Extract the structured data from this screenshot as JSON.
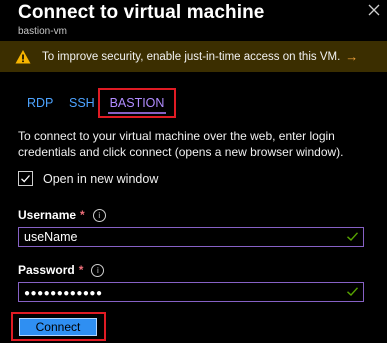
{
  "header": {
    "title": "Connect to virtual machine",
    "subtitle": "bastion-vm"
  },
  "banner": {
    "text": "To improve security, enable just-in-time access on this VM.",
    "arrow": "→",
    "warning_color": "#f7b500"
  },
  "tabs": [
    {
      "label": "RDP"
    },
    {
      "label": "SSH"
    },
    {
      "label": "BASTION",
      "selected": true
    }
  ],
  "description": "To connect to your virtual machine over the web, enter login credentials and click connect (opens a new browser window).",
  "open_new_window": {
    "label": "Open in new window",
    "checked": true
  },
  "username": {
    "label": "Username",
    "required_mark": "*",
    "value": "useName"
  },
  "password": {
    "label": "Password",
    "required_mark": "*",
    "value": "●●●●●●●●●●●●"
  },
  "connect_button": {
    "label": "Connect"
  },
  "colors": {
    "accent": "#8661c5",
    "link": "#4da3ff",
    "primary_button": "#2f8ff2",
    "highlight_box": "#e01b24",
    "success": "#57a300"
  }
}
